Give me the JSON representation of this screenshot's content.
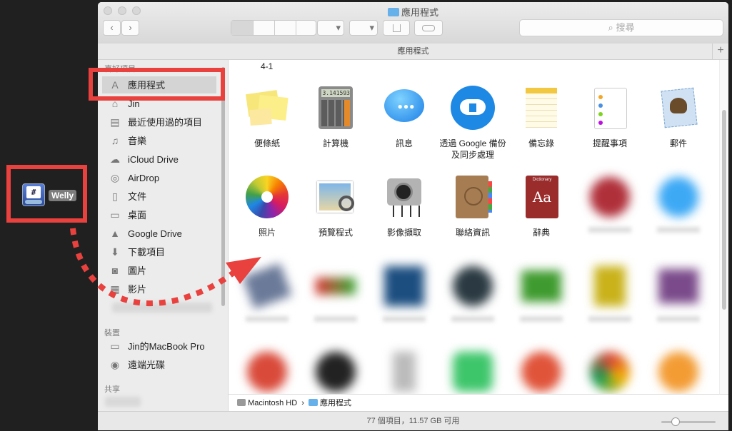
{
  "desktop": {
    "welly_label": "Welly",
    "welly_glyph": "#"
  },
  "window": {
    "title": "應用程式",
    "path_title": "應用程式",
    "search_placeholder": "搜尋",
    "add_tab": "+",
    "toolbar": {
      "back": "‹",
      "forward": "›",
      "arrange": "▾",
      "action": "▾"
    }
  },
  "sidebar": {
    "favorites_label": "喜好項目",
    "favorites": [
      {
        "label": "應用程式",
        "icon": "apps-icon"
      },
      {
        "label": "Jin",
        "icon": "home-icon"
      },
      {
        "label": "最近使用過的項目",
        "icon": "recents-icon"
      },
      {
        "label": "音樂",
        "icon": "music-icon"
      },
      {
        "label": "iCloud Drive",
        "icon": "cloud-icon"
      },
      {
        "label": "AirDrop",
        "icon": "airdrop-icon"
      },
      {
        "label": "文件",
        "icon": "documents-icon"
      },
      {
        "label": "桌面",
        "icon": "desktop-icon"
      },
      {
        "label": "Google Drive",
        "icon": "google-drive-icon"
      },
      {
        "label": "下載項目",
        "icon": "downloads-icon"
      },
      {
        "label": "圖片",
        "icon": "pictures-icon"
      },
      {
        "label": "影片",
        "icon": "movies-icon"
      }
    ],
    "devices_label": "裝置",
    "devices": [
      {
        "label": "Jin的MacBook Pro",
        "icon": "laptop-icon"
      },
      {
        "label": "遠端光碟",
        "icon": "disc-icon"
      }
    ],
    "shared_label": "共享"
  },
  "main": {
    "annotation": "4-1",
    "apps_row1": [
      {
        "label": "便條紙",
        "icon": "stickies-icon"
      },
      {
        "label": "計算機",
        "icon": "calculator-icon"
      },
      {
        "label": "訊息",
        "icon": "messages-icon"
      },
      {
        "label": "透過 Google 備份及同步處理",
        "icon": "google-backup-icon"
      },
      {
        "label": "備忘錄",
        "icon": "notes-icon"
      },
      {
        "label": "提醒事項",
        "icon": "reminders-icon"
      },
      {
        "label": "郵件",
        "icon": "mail-icon"
      }
    ],
    "apps_row2": [
      {
        "label": "照片",
        "icon": "photos-icon"
      },
      {
        "label": "預覽程式",
        "icon": "preview-icon"
      },
      {
        "label": "影像擷取",
        "icon": "image-capture-icon"
      },
      {
        "label": "聯絡資訊",
        "icon": "contacts-icon"
      },
      {
        "label": "辭典",
        "icon": "dictionary-icon"
      }
    ],
    "dictionary_glyph": "Aa",
    "dictionary_caption": "Dictionary",
    "calculator_display": "3.141593"
  },
  "pathbar": {
    "disk": "Macintosh HD",
    "separator": "›",
    "folder": "應用程式"
  },
  "status": {
    "text": "77 個項目，11.57 GB 可用"
  }
}
